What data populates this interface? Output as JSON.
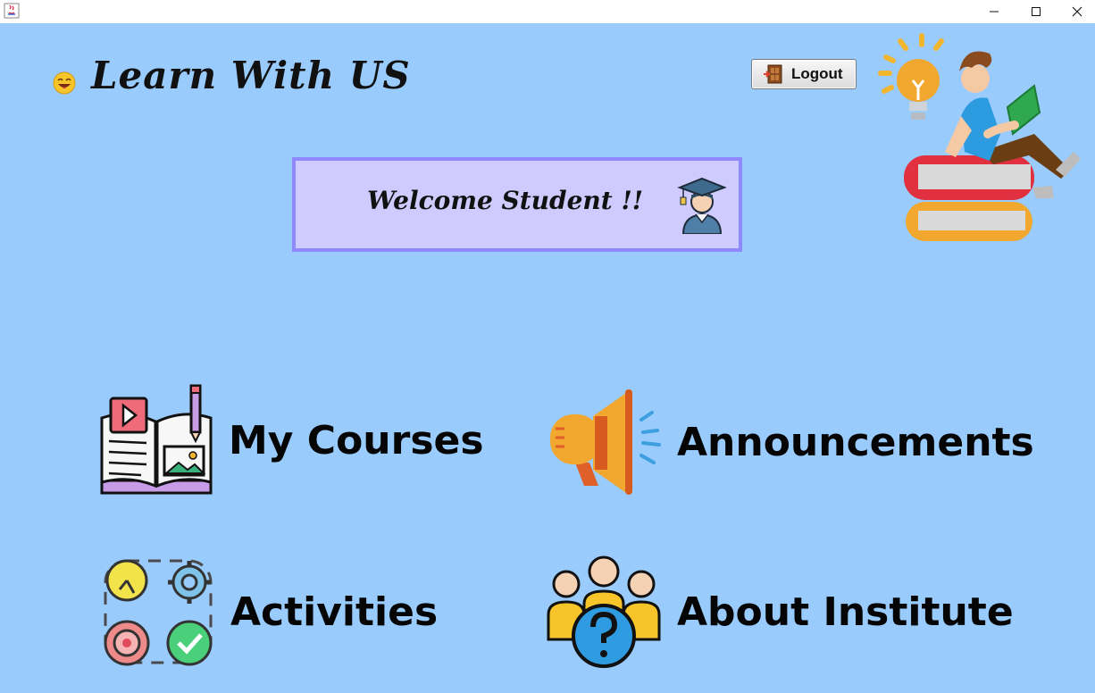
{
  "window": {
    "min_glyph": "—",
    "max_glyph": "☐",
    "close_glyph": "✕"
  },
  "header": {
    "title": "Learn With US",
    "logout_label": "Logout"
  },
  "welcome": {
    "text": "Welcome Student !!"
  },
  "tiles": [
    {
      "label": "My Courses",
      "icon": "book-icon"
    },
    {
      "label": "Announcements",
      "icon": "megaphone-icon"
    },
    {
      "label": "Activities",
      "icon": "activities-icon"
    },
    {
      "label": "About Institute",
      "icon": "group-question-icon"
    }
  ],
  "colors": {
    "background": "#99cbfc",
    "welcome_bg": "#cfcbff",
    "welcome_border": "#8f88ff"
  }
}
